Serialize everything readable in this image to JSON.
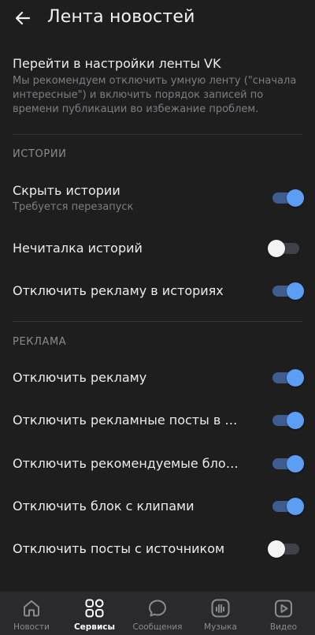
{
  "header": {
    "title": "Лента новостей"
  },
  "vk_settings": {
    "title": "Перейти в настройки ленты VK",
    "description_lines": [
      "Мы рекомендуем отключить умную ленту (\"сначала",
      "интересные\") и включить порядок записей по",
      "времени публикации во избежание проблем."
    ]
  },
  "sections": [
    {
      "header": "ИСТОРИИ",
      "items": [
        {
          "label": "Скрыть истории",
          "sub": "Требуется перезапуск",
          "on": true
        },
        {
          "label": "Нечиталка историй",
          "on": false
        },
        {
          "label": "Отключить рекламу в историях",
          "on": true
        }
      ]
    },
    {
      "header": "РЕКЛАМА",
      "items": [
        {
          "label": "Отключить рекламу",
          "on": true
        },
        {
          "label": "Отключить рекламные посты в груп…",
          "on": true
        },
        {
          "label": "Отключить рекомендуемые блоки",
          "on": true
        },
        {
          "label": "Отключить блок с клипами",
          "on": true
        },
        {
          "label": "Отключить посты с источником",
          "on": false
        }
      ]
    }
  ],
  "tabbar": [
    {
      "label": "Новости",
      "icon": "home-icon",
      "active": false
    },
    {
      "label": "Сервисы",
      "icon": "services-grid-icon",
      "active": true
    },
    {
      "label": "Сообщения",
      "icon": "chat-bubble-icon",
      "active": false
    },
    {
      "label": "Музыка",
      "icon": "music-icon",
      "active": false
    },
    {
      "label": "Видео",
      "icon": "video-play-icon",
      "active": false
    }
  ],
  "colors": {
    "background": "#1e1e1f",
    "switch_on_knob": "#5c9ef3",
    "switch_on_track": "#3f5c8e",
    "switch_off_knob": "#f3f3f3",
    "tabbar_bg": "#2a2a2c"
  }
}
